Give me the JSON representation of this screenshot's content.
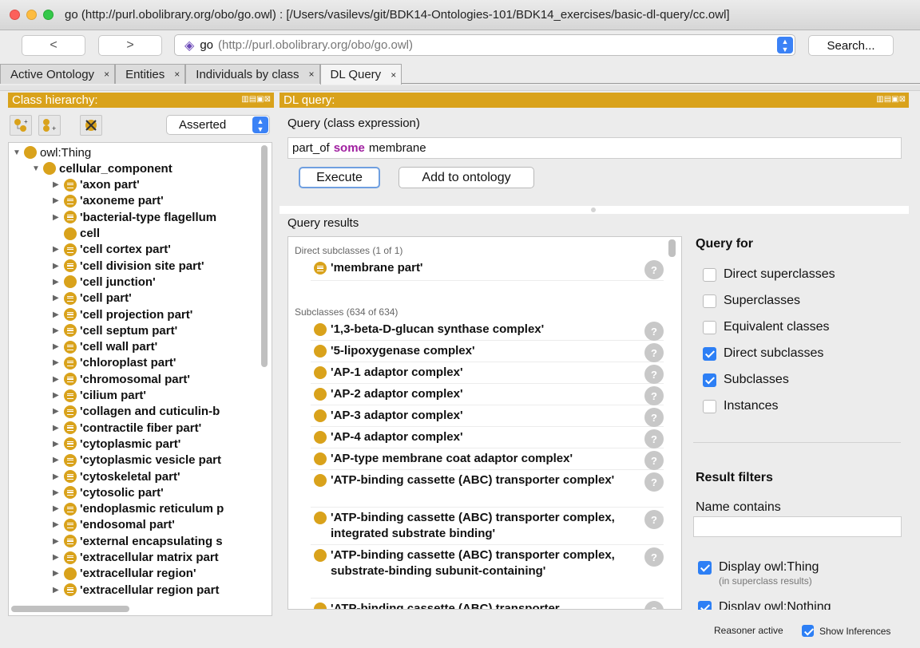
{
  "window": {
    "title": "go (http://purl.obolibrary.org/obo/go.owl)  : [/Users/vasilevs/git/BDK14-Ontologies-101/BDK14_exercises/basic-dl-query/cc.owl]"
  },
  "toolbar": {
    "back_label": "<",
    "forward_label": ">",
    "ontology_name": "go",
    "ontology_iri": "(http://purl.obolibrary.org/obo/go.owl)",
    "search_label": "Search..."
  },
  "tabs": [
    {
      "label": "Active Ontology",
      "close": "×"
    },
    {
      "label": "Entities",
      "close": "×"
    },
    {
      "label": "Individuals by class",
      "close": "×"
    },
    {
      "label": "DL Query",
      "close": "×"
    }
  ],
  "class_hierarchy": {
    "header": "Class hierarchy:",
    "mode": "Asserted",
    "items": [
      {
        "label": "owl:Thing",
        "expander": "▼",
        "bullet": "plain"
      },
      {
        "label": "cellular_component",
        "expander": "▼",
        "bullet": "plain"
      },
      {
        "label": "'axon part'",
        "expander": "▶",
        "bullet": "defined"
      },
      {
        "label": "'axoneme part'",
        "expander": "▶",
        "bullet": "defined"
      },
      {
        "label": "'bacterial-type flagellum",
        "expander": "▶",
        "bullet": "defined"
      },
      {
        "label": "cell",
        "expander": "",
        "bullet": "plain"
      },
      {
        "label": "'cell cortex part'",
        "expander": "▶",
        "bullet": "defined"
      },
      {
        "label": "'cell division site part'",
        "expander": "▶",
        "bullet": "defined"
      },
      {
        "label": "'cell junction'",
        "expander": "▶",
        "bullet": "plain"
      },
      {
        "label": "'cell part'",
        "expander": "▶",
        "bullet": "defined"
      },
      {
        "label": "'cell projection part'",
        "expander": "▶",
        "bullet": "defined"
      },
      {
        "label": "'cell septum part'",
        "expander": "▶",
        "bullet": "defined"
      },
      {
        "label": "'cell wall part'",
        "expander": "▶",
        "bullet": "defined"
      },
      {
        "label": "'chloroplast part'",
        "expander": "▶",
        "bullet": "defined"
      },
      {
        "label": "'chromosomal part'",
        "expander": "▶",
        "bullet": "defined"
      },
      {
        "label": "'cilium part'",
        "expander": "▶",
        "bullet": "defined"
      },
      {
        "label": "'collagen and cuticulin-b",
        "expander": "▶",
        "bullet": "defined"
      },
      {
        "label": "'contractile fiber part'",
        "expander": "▶",
        "bullet": "defined"
      },
      {
        "label": "'cytoplasmic part'",
        "expander": "▶",
        "bullet": "defined"
      },
      {
        "label": "'cytoplasmic vesicle part",
        "expander": "▶",
        "bullet": "defined"
      },
      {
        "label": "'cytoskeletal part'",
        "expander": "▶",
        "bullet": "defined"
      },
      {
        "label": "'cytosolic part'",
        "expander": "▶",
        "bullet": "defined"
      },
      {
        "label": "'endoplasmic reticulum p",
        "expander": "▶",
        "bullet": "defined"
      },
      {
        "label": "'endosomal part'",
        "expander": "▶",
        "bullet": "defined"
      },
      {
        "label": "'external encapsulating s",
        "expander": "▶",
        "bullet": "defined"
      },
      {
        "label": "'extracellular matrix part",
        "expander": "▶",
        "bullet": "defined"
      },
      {
        "label": "'extracellular region'",
        "expander": "▶",
        "bullet": "plain"
      },
      {
        "label": "'extracellular region part",
        "expander": "▶",
        "bullet": "defined"
      }
    ]
  },
  "dl_query": {
    "header": "DL query:",
    "query_label": "Query (class expression)",
    "expression": {
      "before": "part_of",
      "keyword": "some",
      "after": "membrane"
    },
    "execute_label": "Execute",
    "add_label": "Add to ontology",
    "results_label": "Query results",
    "direct_header": "Direct subclasses (1 of 1)",
    "direct_results": [
      "'membrane part'"
    ],
    "sub_header": "Subclasses (634 of 634)",
    "sub_results": [
      "'1,3-beta-D-glucan synthase complex'",
      "'5-lipoxygenase complex'",
      "'AP-1 adaptor complex'",
      "'AP-2 adaptor complex'",
      "'AP-3 adaptor complex'",
      "'AP-4 adaptor complex'",
      "'AP-type membrane coat adaptor complex'",
      "'ATP-binding cassette (ABC) transporter complex'",
      "'ATP-binding cassette (ABC) transporter complex, integrated substrate binding'",
      "'ATP-binding cassette (ABC) transporter complex, substrate-binding subunit-containing'",
      "'ATP-binding cassette (ABC) transporter"
    ],
    "help_glyph": "?"
  },
  "query_for": {
    "title": "Query for",
    "options": [
      {
        "label": "Direct superclasses",
        "checked": false
      },
      {
        "label": "Superclasses",
        "checked": false
      },
      {
        "label": "Equivalent classes",
        "checked": false
      },
      {
        "label": "Direct subclasses",
        "checked": true
      },
      {
        "label": "Subclasses",
        "checked": true
      },
      {
        "label": "Instances",
        "checked": false
      }
    ]
  },
  "result_filters": {
    "title": "Result filters",
    "name_contains_label": "Name contains",
    "name_contains_value": "",
    "display_thing_label": "Display owl:Thing",
    "display_thing_note": "(in superclass results)",
    "display_thing_checked": true,
    "display_nothing_label": "Display owl:Nothing",
    "display_nothing_checked": true
  },
  "status_bar": {
    "reasoner": "Reasoner active",
    "show_inferences_label": "Show Inferences",
    "show_inferences_checked": true
  },
  "colors": {
    "accent": "#d9a21b",
    "keyword": "#a020a0",
    "checkbox": "#2d7ff5"
  }
}
